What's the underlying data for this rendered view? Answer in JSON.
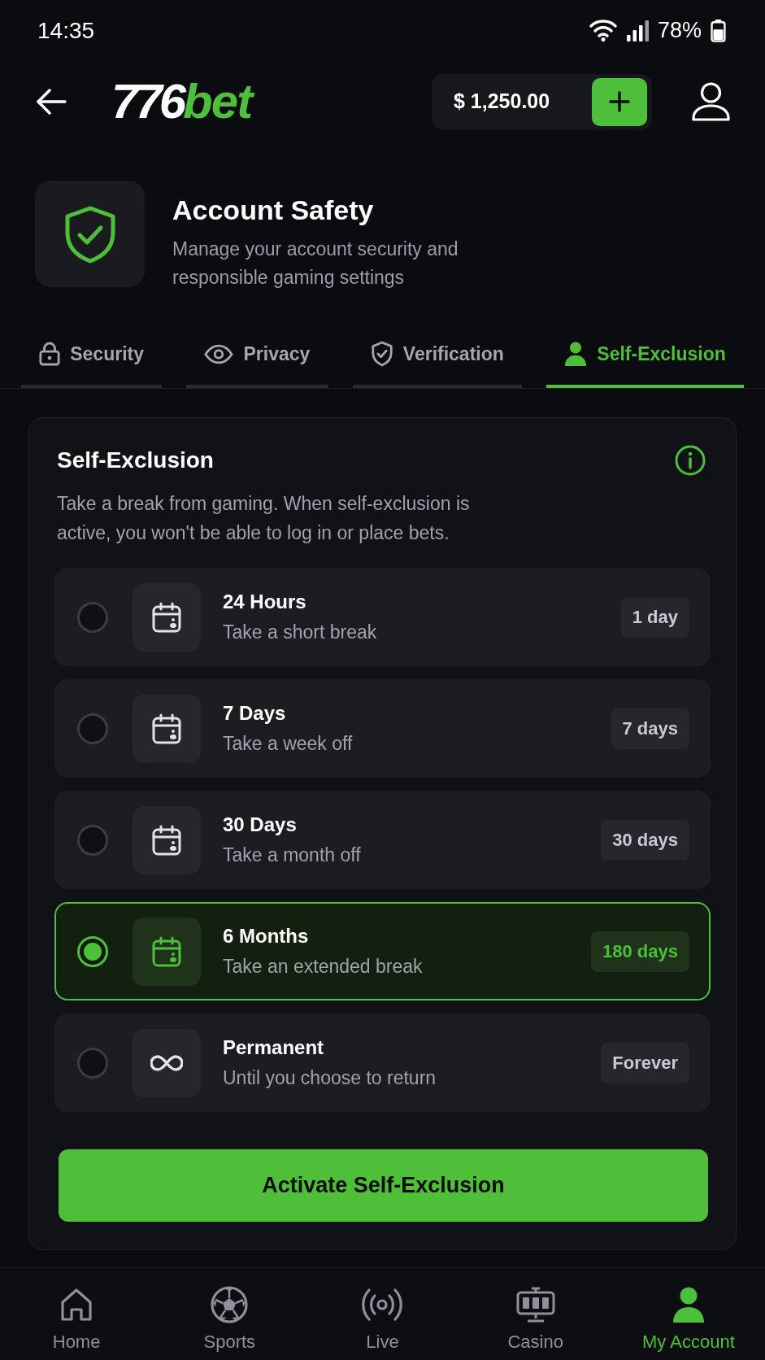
{
  "status_bar": {
    "time": "14:35",
    "battery": "78%"
  },
  "header": {
    "logo": {
      "numerals": "776",
      "word": "bet"
    },
    "balance": "$ 1,250.00"
  },
  "page_header": {
    "title": "Account Safety",
    "subtitle": "Manage your account security and responsible gaming settings"
  },
  "tabs": [
    {
      "label": "Security",
      "selected": false
    },
    {
      "label": "Privacy",
      "selected": false
    },
    {
      "label": "Verification",
      "selected": false
    },
    {
      "label": "Self-Exclusion",
      "selected": true
    }
  ],
  "card": {
    "title": "Self-Exclusion",
    "description": "Take a break from gaming. When self-exclusion is active, you won't be able to log in or place bets.",
    "options": [
      {
        "kind": "period",
        "title": "24 Hours",
        "subtitle": "Take a short break",
        "duration": "1 day",
        "selected": false
      },
      {
        "kind": "period",
        "title": "7 Days",
        "subtitle": "Take a week off",
        "duration": "7 days",
        "selected": false
      },
      {
        "kind": "period",
        "title": "30 Days",
        "subtitle": "Take a month off",
        "duration": "30 days",
        "selected": false
      },
      {
        "kind": "period",
        "title": "6 Months",
        "subtitle": "Take an extended break",
        "duration": "180 days",
        "selected": true
      },
      {
        "kind": "permanent",
        "title": "Permanent",
        "subtitle": "Until you choose to return",
        "duration": "Forever",
        "selected": false
      }
    ],
    "button": "Activate Self-Exclusion"
  },
  "bottom_nav": [
    {
      "label": "Home",
      "selected": false
    },
    {
      "label": "Sports",
      "selected": false
    },
    {
      "label": "Live",
      "selected": false
    },
    {
      "label": "Casino",
      "selected": false
    },
    {
      "label": "My Account",
      "selected": true
    }
  ]
}
